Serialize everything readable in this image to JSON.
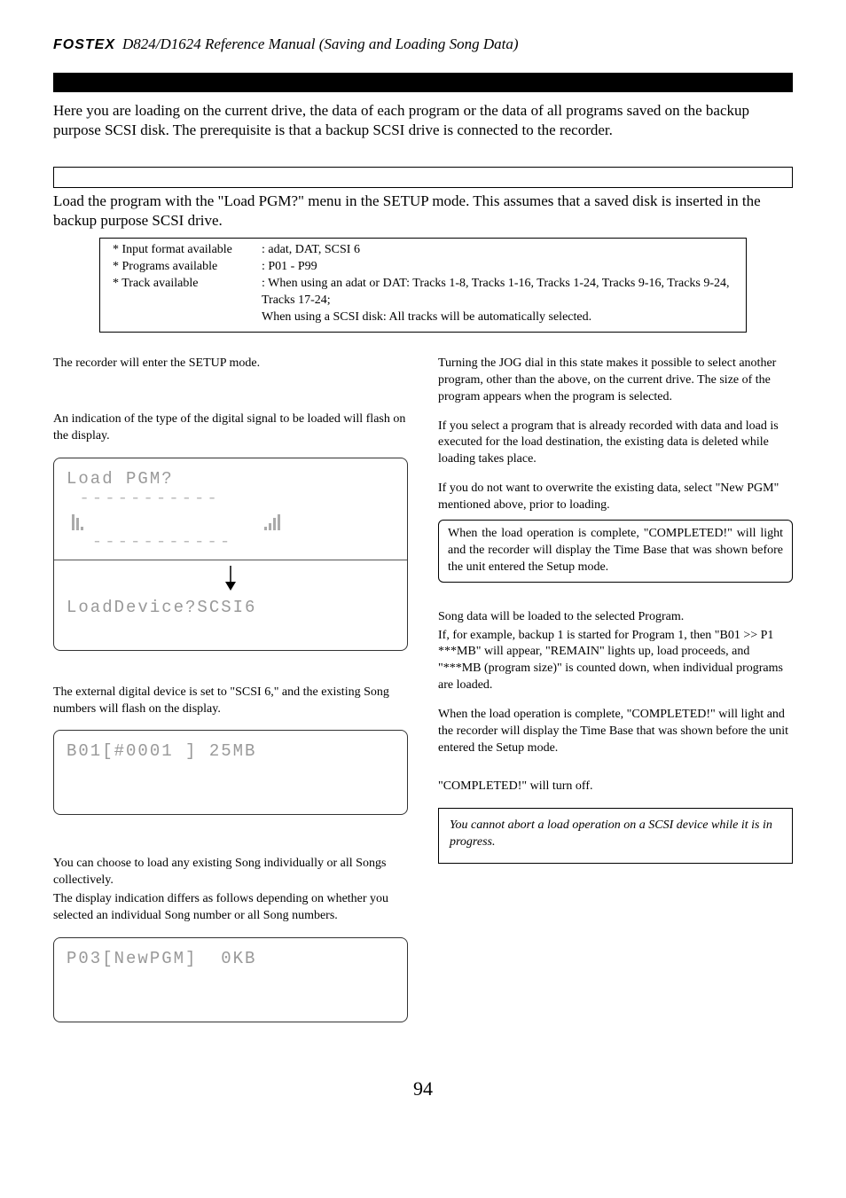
{
  "header": {
    "brand": "FOSTEX",
    "title": "D824/D1624 Reference Manual (Saving and Loading Song Data)"
  },
  "intro": "Here you are loading on the current drive, the data of each program or the data of all programs saved on the backup purpose SCSI disk.  The prerequisite is that a backup SCSI drive is connected to the recorder.",
  "proc_intro": "Load the program with the \"Load PGM?\" menu in the SETUP mode.  This assumes that a saved disk is inserted in the backup purpose SCSI drive.",
  "spec": {
    "r1_label": "* Input format available",
    "r1_value": ": adat, DAT, SCSI 6",
    "r2_label": "* Programs available",
    "r2_value": ": P01 - P99",
    "r3_label": "* Track available",
    "r3_value": ": When using an adat or DAT: Tracks 1-8, Tracks 1-16, Tracks 1-24, Tracks 9-16,    Tracks 9-24, Tracks 17-24;",
    "r3_extra": "When using a SCSI disk: All tracks will be automatically selected."
  },
  "left": {
    "p1": "The recorder will enter the SETUP mode.",
    "p2": "An indication of the type of the digital signal to be loaded will flash on the display.",
    "lcd1": "Load PGM?",
    "lcd1b": "LoadDevice?SCSI6",
    "p3": "The external digital device is set to \"SCSI 6,\" and the existing Song numbers will flash on the display.",
    "lcd2": "B01[#0001 ] 25MB",
    "p4": "You can choose to load any existing Song individually or all Songs collectively.",
    "p5": "The display indication differs as follows depending on whether you selected an individual Song number or all Song numbers.",
    "lcd3": "P03[NewPGM]  0KB"
  },
  "right": {
    "p1": "Turning the JOG dial in this state makes it possible to select another program, other than the above, on the current drive.  The size of the program appears when the program is selected.",
    "p2": "If you select a program that is already recorded with data and load is executed for the load destination, the existing data is deleted while loading takes place.",
    "p3": "If you do not want to overwrite the existing data, select \"New PGM\" mentioned above, prior to loading.",
    "box1": "When the load operation is complete, \"COMPLETED!\" will light and the recorder will display the Time Base that was shown before the unit entered the Setup mode.",
    "p4a": "Song data will be loaded to the selected Program.",
    "p4b": "If, for example, backup 1 is started for Program 1, then \"B01 >> P1  ***MB\" will appear, \"REMAIN\" lights up, load proceeds, and \"***MB (program size)\" is counted down, when individual programs are loaded.",
    "p5": "When the load operation is complete, \"COMPLETED!\" will light and the recorder will display the Time Base that was shown before the unit entered the Setup mode.",
    "p6": "\"COMPLETED!\" will turn off.",
    "note": "You cannot abort a load operation on a SCSI device while it is in progress."
  },
  "page_number": "94"
}
